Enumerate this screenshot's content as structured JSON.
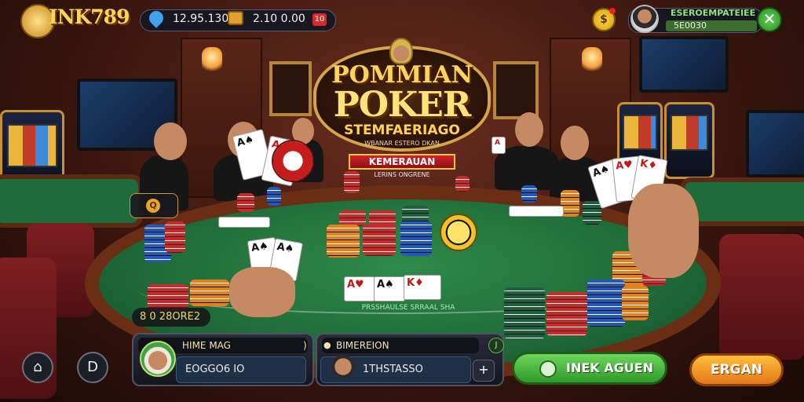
{
  "topbar": {
    "logo_text": "INK789",
    "logo_sub": "",
    "gem_value": "12.95.130",
    "chest_value": "2.10 0.00",
    "dice_label": "10",
    "coin_label": "$",
    "profile_name": "ESEROEMPATEIEE",
    "profile_balance": "5E0030",
    "close_label": "✕"
  },
  "title_sign": {
    "line1": "POMMIAN",
    "line2": "POKER",
    "line3": "STEMFAERIAGO",
    "line4": "WBANAR ESTERO DKAN",
    "ribbon": "KEMERAUAN",
    "ribbon_sub": "LERINS ONGRENE"
  },
  "table": {
    "seat_tag_label": "Q",
    "pot_label": "8 0 28ORE2",
    "felt_text": "PRSSHAULSE SRRAAL SHA"
  },
  "bottom": {
    "left_icon_1": "⌂",
    "left_icon_2": "D",
    "player1": {
      "header": "HIME MAG",
      "header_right": ")",
      "value": "EOGGO6 IO"
    },
    "player2": {
      "header": "BIMEREION",
      "header_right": "J",
      "value": "1THSTASSO",
      "action": "+"
    },
    "green_button": "INEK AGUEN",
    "orange_button": "ERGAN"
  },
  "colors": {
    "gold": "#ffd35a",
    "felt": "#1f6a38",
    "rail": "#6a2e15",
    "green_button": "#2e9a2a",
    "orange_button": "#e2781a"
  },
  "icons": [
    "gem-icon",
    "treasure-chest-icon",
    "dice-icon",
    "coin-icon",
    "close-icon",
    "home-icon",
    "d-icon",
    "plus-icon",
    "chip-icon"
  ]
}
